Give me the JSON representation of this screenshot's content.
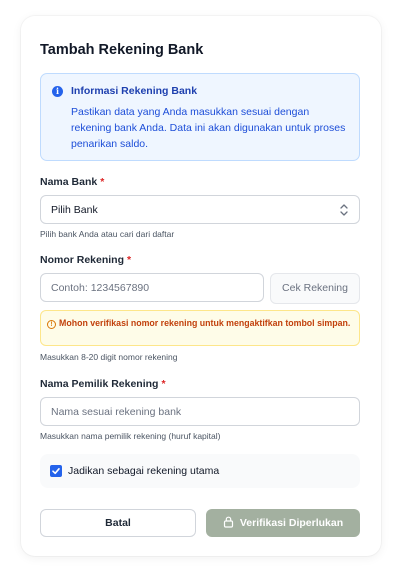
{
  "dialog": {
    "title": "Tambah Rekening Bank"
  },
  "info": {
    "icon": "info-icon",
    "title": "Informasi Rekening Bank",
    "text": "Pastikan data yang Anda masukkan sesuai dengan rekening bank Anda. Data ini akan digunakan untuk proses penarikan saldo."
  },
  "bank": {
    "label": "Nama Bank",
    "required_mark": "*",
    "selected": "Pilih Bank",
    "hint": "Pilih bank Anda atau cari dari daftar"
  },
  "account_number": {
    "label": "Nomor Rekening",
    "required_mark": "*",
    "placeholder": "Contoh: 1234567890",
    "value": "",
    "check_button": "Cek Rekening",
    "warning": "Mohon verifikasi nomor rekening untuk mengaktifkan tombol simpan.",
    "hint": "Masukkan 8-20 digit nomor rekening"
  },
  "owner": {
    "label": "Nama Pemilik Rekening",
    "required_mark": "*",
    "placeholder": "Nama sesuai rekening bank",
    "value": "",
    "hint": "Masukkan nama pemilik rekening (huruf kapital)"
  },
  "primary": {
    "label": "Jadikan sebagai rekening utama",
    "checked": true
  },
  "actions": {
    "cancel": "Batal",
    "verify": "Verifikasi Diperlukan"
  },
  "colors": {
    "accent": "#2563eb",
    "required": "#dc2626",
    "warning": "#c2410c",
    "verify_disabled": "#a3b0a0"
  }
}
